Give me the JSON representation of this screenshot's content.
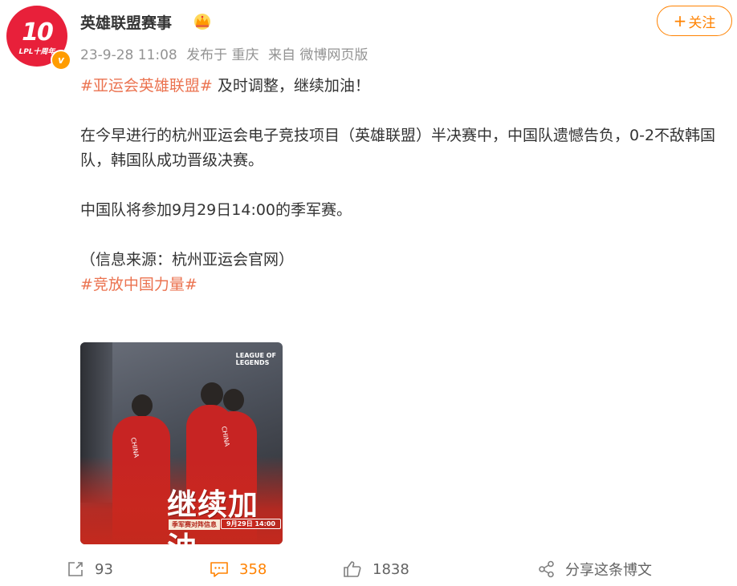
{
  "account": {
    "name": "英雄联盟赛事",
    "avatar_text": "10",
    "avatar_subtext": "LPL十周年",
    "verified_badge": "v"
  },
  "meta": {
    "date": "23-9-28 11:08",
    "location": "发布于 重庆",
    "source": "来自 微博网页版"
  },
  "follow": {
    "plus": "+",
    "label": "关注"
  },
  "post": {
    "hashtag1": "#亚运会英雄联盟#",
    "headline_rest": " 及时调整，继续加油！",
    "paragraph1": "在今早进行的杭州亚运会电子竞技项目（英雄联盟）半决赛中，中国队遗憾告负，0-2不敌韩国队，韩国队成功晋级决赛。",
    "paragraph2": "中国队将参加9月29日14:00的季军赛。",
    "source_note": "（信息来源：杭州亚运会官网）",
    "hashtag2": "#竞放中国力量#"
  },
  "image": {
    "logo_line1": "LEAGUE OF",
    "logo_line2": "LEGENDS",
    "jersey_text": "CHINA",
    "title": "继续加油",
    "tag_left": "季军赛对阵信息",
    "tag_right": "9月29日 14:00"
  },
  "actions": {
    "share_count": "93",
    "comment_count": "358",
    "like_count": "1838",
    "share_post_label": "分享这条博文"
  },
  "colors": {
    "accent": "#ff8200",
    "hashtag": "#eb7350",
    "meta": "#939393"
  }
}
